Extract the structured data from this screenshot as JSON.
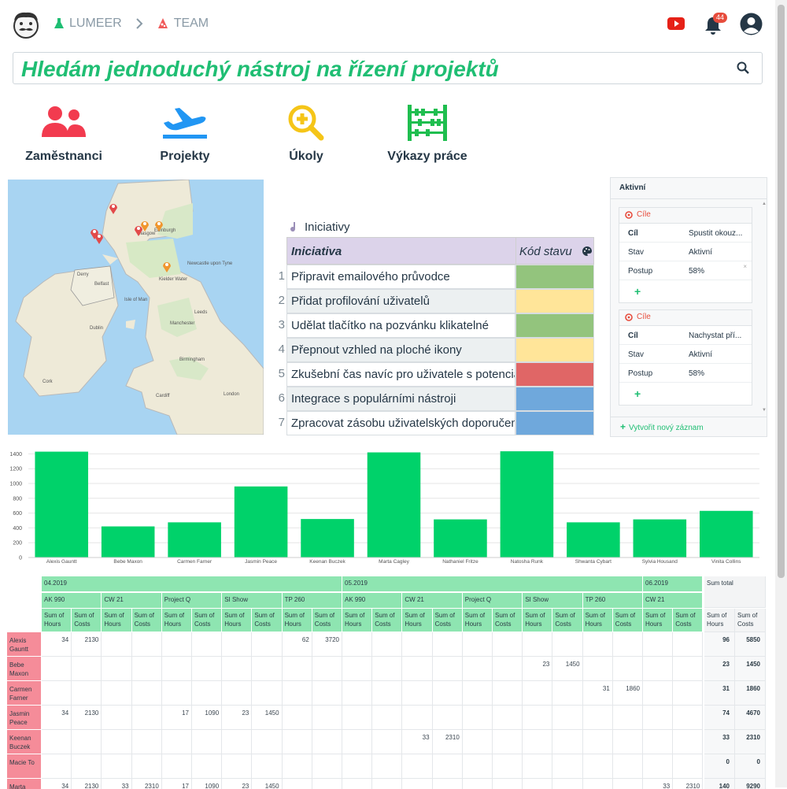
{
  "breadcrumb": {
    "org": "LUMEER",
    "project": "TEAM"
  },
  "notifications": {
    "count": "44"
  },
  "search": {
    "query": "Hledám jednoduchý nástroj na řízení projektů"
  },
  "tiles": [
    {
      "label": "Zaměstnanci",
      "icon": "users-icon"
    },
    {
      "label": "Projekty",
      "icon": "plane-icon"
    },
    {
      "label": "Úkoly",
      "icon": "magnifier-plus-icon"
    },
    {
      "label": "Výkazy práce",
      "icon": "abacus-icon"
    }
  ],
  "map": {
    "labels": [
      "Glasgow",
      "Edinburgh",
      "Belfast",
      "Isle of Man",
      "Newcastle upon Tyne",
      "Leeds",
      "Manchester",
      "Dublin",
      "Birmingham",
      "Cork",
      "Cardiff",
      "London",
      "Derry",
      "Kielder Water"
    ]
  },
  "table": {
    "title": "Iniciativy",
    "col_name": "Iniciativa",
    "col_code": "Kód stavu",
    "rows": [
      {
        "n": "1",
        "name": "Připravit emailového průvodce",
        "color": "#93c47d"
      },
      {
        "n": "2",
        "name": "Přidat profilování uživatelů",
        "color": "#ffe599"
      },
      {
        "n": "3",
        "name": "Udělat tlačítko na pozvánku klikatelné",
        "color": "#93c47d"
      },
      {
        "n": "4",
        "name": "Přepnout vzhled na ploché ikony",
        "color": "#ffe599"
      },
      {
        "n": "5",
        "name": "Zkušební čas navíc pro uživatele s potenciálem",
        "color": "#e06666"
      },
      {
        "n": "6",
        "name": "Integrace s populárními nástroji",
        "color": "#6fa8dc"
      },
      {
        "n": "7",
        "name": "Zpracovat zásobu uživatelských doporučení",
        "color": "#6fa8dc"
      }
    ]
  },
  "panel": {
    "title": "Aktivní",
    "cards": [
      {
        "header": "Cíle",
        "rows": [
          [
            "Cíl",
            "Spustit okouz..."
          ],
          [
            "Stav",
            "Aktivní"
          ],
          [
            "Postup",
            "58%"
          ]
        ]
      },
      {
        "header": "Cíle",
        "rows": [
          [
            "Cíl",
            "Nachystat pří..."
          ],
          [
            "Stav",
            "Aktivní"
          ],
          [
            "Postup",
            "58%"
          ]
        ]
      }
    ],
    "new_record": "Vytvořit nový záznam"
  },
  "chart_data": {
    "type": "bar",
    "categories": [
      "Alexis Gauntt",
      "Bebe Maxon",
      "Carmen Farner",
      "Jasmin Peace",
      "Keenan Buczek",
      "Marta Cagley",
      "Nathaniel Fritze",
      "Natosha Runk",
      "Shwanta Cybart",
      "Sylvia Housand",
      "Vinita Collins"
    ],
    "values": [
      1430,
      420,
      475,
      960,
      520,
      1420,
      515,
      1435,
      475,
      515,
      630
    ],
    "ylim": [
      0,
      1500
    ],
    "yticks": [
      "0",
      "200",
      "400",
      "600",
      "800",
      "1000",
      "1200",
      "1400"
    ],
    "color": "#00d26a",
    "grid": true
  },
  "pivot": {
    "months": [
      {
        "label": "04.2019",
        "span": 10
      },
      {
        "label": "05.2019",
        "span": 10
      },
      {
        "label": "06.2019",
        "span": 2
      }
    ],
    "total_label": "Sum total",
    "projects": [
      {
        "label": "AK 990",
        "span": 2
      },
      {
        "label": "CW 21",
        "span": 2
      },
      {
        "label": "Project Q",
        "span": 2
      },
      {
        "label": "SI Show",
        "span": 2
      },
      {
        "label": "TP 260",
        "span": 2
      },
      {
        "label": "AK 990",
        "span": 2
      },
      {
        "label": "CW 21",
        "span": 2
      },
      {
        "label": "Project Q",
        "span": 2
      },
      {
        "label": "SI Show",
        "span": 2
      },
      {
        "label": "TP 260",
        "span": 2
      },
      {
        "label": "CW 21",
        "span": 2
      }
    ],
    "measure_a": "Sum of Hours",
    "measure_b": "Sum of Costs",
    "rows": [
      {
        "name": "Alexis Gauntt",
        "cells": [
          "34",
          "2130",
          "",
          "",
          "",
          "",
          "",
          "",
          "62",
          "3720",
          "",
          "",
          "",
          "",
          "",
          "",
          "",
          "",
          "",
          "",
          "",
          ""
        ],
        "total": [
          "96",
          "5850"
        ]
      },
      {
        "name": "Bebe Maxon",
        "cells": [
          "",
          "",
          "",
          "",
          "",
          "",
          "",
          "",
          "",
          "",
          "",
          "",
          "",
          "",
          "",
          "",
          "23",
          "1450",
          "",
          "",
          "",
          ""
        ],
        "total": [
          "23",
          "1450"
        ]
      },
      {
        "name": "Carmen Farner",
        "cells": [
          "",
          "",
          "",
          "",
          "",
          "",
          "",
          "",
          "",
          "",
          "",
          "",
          "",
          "",
          "",
          "",
          "",
          "",
          "31",
          "1860",
          "",
          ""
        ],
        "total": [
          "31",
          "1860"
        ]
      },
      {
        "name": "Jasmin Peace",
        "cells": [
          "34",
          "2130",
          "",
          "",
          "17",
          "1090",
          "23",
          "1450",
          "",
          "",
          "",
          "",
          "",
          "",
          "",
          "",
          "",
          "",
          "",
          "",
          "",
          ""
        ],
        "total": [
          "74",
          "4670"
        ]
      },
      {
        "name": "Keenan Buczek",
        "cells": [
          "",
          "",
          "",
          "",
          "",
          "",
          "",
          "",
          "",
          "",
          "",
          "",
          "33",
          "2310",
          "",
          "",
          "",
          "",
          "",
          "",
          "",
          ""
        ],
        "total": [
          "33",
          "2310"
        ]
      },
      {
        "name": "Macie To",
        "cells": [
          "",
          "",
          "",
          "",
          "",
          "",
          "",
          "",
          "",
          "",
          "",
          "",
          "",
          "",
          "",
          "",
          "",
          "",
          "",
          "",
          "",
          ""
        ],
        "total": [
          "0",
          "0"
        ]
      },
      {
        "name": "Marta Cagley",
        "cells": [
          "34",
          "2130",
          "33",
          "2310",
          "17",
          "1090",
          "23",
          "1450",
          "",
          "",
          "",
          "",
          "",
          "",
          "",
          "",
          "",
          "",
          "",
          "",
          "33",
          "2310"
        ],
        "total": [
          "140",
          "9290"
        ]
      }
    ]
  }
}
